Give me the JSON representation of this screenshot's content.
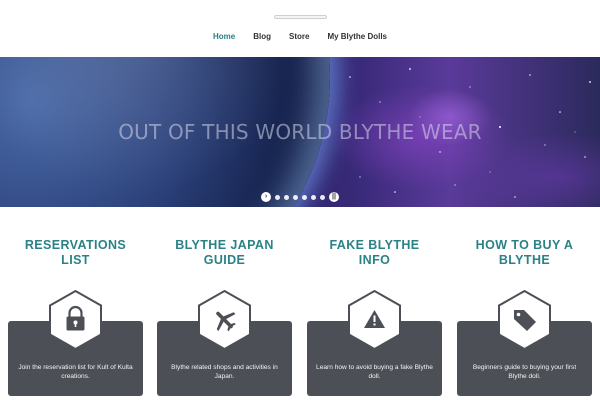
{
  "nav": {
    "items": [
      {
        "label": "Home",
        "active": true
      },
      {
        "label": "Blog",
        "active": false
      },
      {
        "label": "Store",
        "active": false
      },
      {
        "label": "My Blythe Dolls",
        "active": false
      }
    ]
  },
  "hero": {
    "title": "OUT OF THIS WORLD BLYTHE WEAR",
    "slide_count": 7,
    "colors": {
      "space": "#2b2a5c",
      "nebula": "#8b55d6"
    }
  },
  "features": [
    {
      "title_line1": "RESERVATIONS",
      "title_line2": "LIST",
      "icon": "lock-icon",
      "text": "Join the reservation list for Kult of Kulta creations."
    },
    {
      "title_line1": "BLYTHE JAPAN",
      "title_line2": "GUIDE",
      "icon": "airplane-icon",
      "text": "Blythe related shops and activities in Japan."
    },
    {
      "title_line1": "FAKE BLYTHE",
      "title_line2": "INFO",
      "icon": "warning-icon",
      "text": "Learn how to avoid buying a fake Blythe doll."
    },
    {
      "title_line1": "HOW TO BUY A",
      "title_line2": "BLYTHE",
      "icon": "tag-icon",
      "text": "Beginners guide to buying your first Blythe doll."
    }
  ],
  "colors": {
    "accent": "#2a8286",
    "card": "#4c5056"
  }
}
